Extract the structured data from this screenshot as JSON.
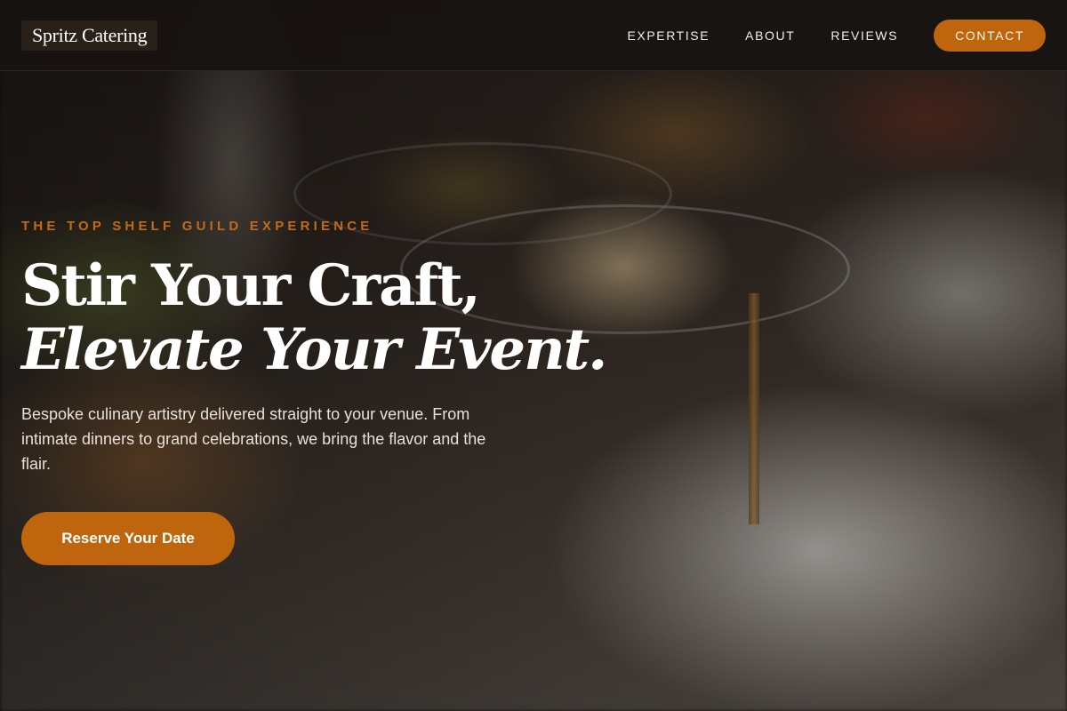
{
  "header": {
    "logo_text": "Spritz Catering",
    "nav": {
      "expertise": "EXPERTISE",
      "about": "ABOUT",
      "reviews": "REVIEWS",
      "contact": "CONTACT"
    }
  },
  "hero": {
    "eyebrow": "THE TOP SHELF GUILD EXPERIENCE",
    "headline_line1": "Stir Your Craft,",
    "headline_line2": "Elevate Your Event.",
    "subtext": "Bespoke culinary artistry delivered straight to your venue. From intimate dinners to grand celebrations, we bring the flavor and the flair.",
    "cta_label": "Reserve Your Date"
  },
  "colors": {
    "accent": "#bf650d",
    "eyebrow": "#c26a18",
    "header_bg": "#181412",
    "text_light": "#ffffff"
  }
}
